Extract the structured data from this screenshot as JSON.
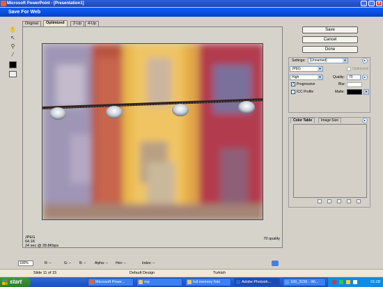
{
  "ppt_window": {
    "title": "Microsoft PowerPoint - [Presentation1]"
  },
  "dialog": {
    "title": "Save For Web"
  },
  "tabs": [
    {
      "label": "Original"
    },
    {
      "label": "Optimized"
    },
    {
      "label": "2-Up"
    },
    {
      "label": "4-Up"
    }
  ],
  "preview_info": {
    "format": "JPEG",
    "size": "64.1K",
    "time": "24 sec @ 28.8Kbps",
    "quality": "70 quality"
  },
  "status": {
    "zoom": "100%",
    "r": "R: --",
    "g": "G: --",
    "b": "B: --",
    "alpha": "Alpha: --",
    "hex": "Hex: --",
    "index": "Index: --"
  },
  "buttons": {
    "save": "Save",
    "cancel": "Cancel",
    "done": "Done"
  },
  "settings": {
    "label": "Settings:",
    "preset": "[Unnamed]",
    "format": "JPEG",
    "optimized": "Optimized",
    "compression": "High",
    "quality_label": "Quality:",
    "quality_value": "70",
    "progressive": "Progressive",
    "blur_label": "Blur:",
    "icc_profile": "ICC Profile",
    "matte_label": "Matte:"
  },
  "color_panel": {
    "tab_color_table": "Color Table",
    "tab_image_size": "Image Size"
  },
  "ppt_status": {
    "slide": "Slide 11 of 15",
    "design": "Default Design",
    "language": "Turkish"
  },
  "taskbar": {
    "start": "start",
    "tasks": [
      {
        "label": "Microsoft Powe...",
        "color": "#e8622b"
      },
      {
        "label": "mp",
        "color": "#f0c94a"
      },
      {
        "label": "full memory foto",
        "color": "#f0c94a"
      },
      {
        "label": "Adobe Photosh...",
        "color": "#1c6bd8"
      },
      {
        "label": "100_3156 - Wi...",
        "color": "#5aa0e8"
      }
    ],
    "clock": "01:28"
  },
  "colors": {
    "titlebar": "#1d46b8",
    "dialog_bg": "#d4d0c8",
    "taskbar": "#1c4ec2",
    "start": "#2c7d2c"
  }
}
